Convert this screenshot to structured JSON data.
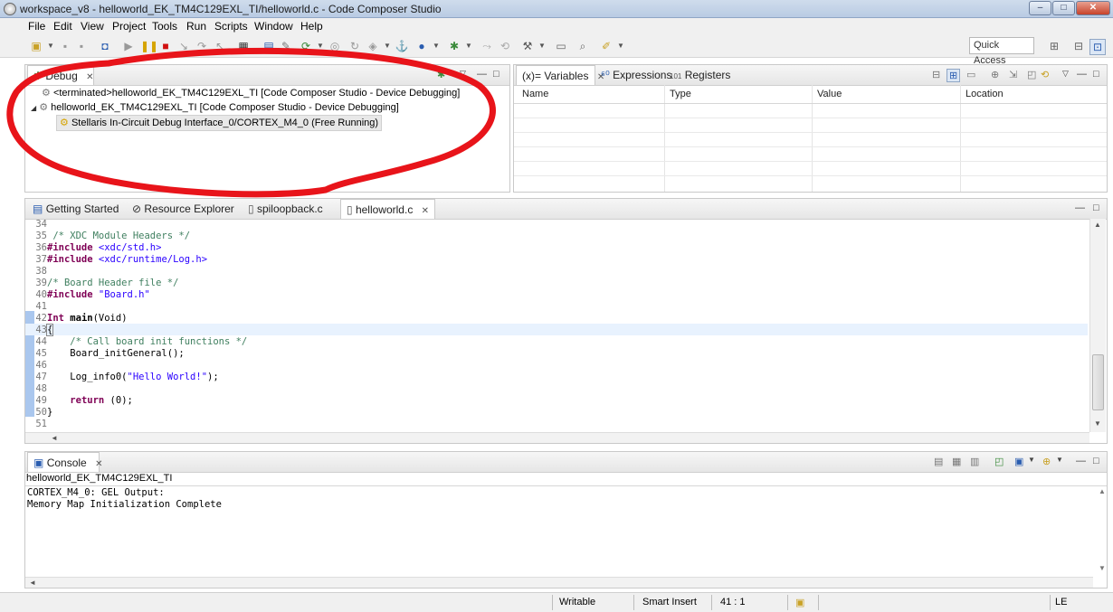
{
  "window": {
    "title": "workspace_v8 - helloworld_EK_TM4C129EXL_TI/helloworld.c - Code Composer Studio",
    "minimize": "–",
    "maximize": "□",
    "close": "✕"
  },
  "menu": [
    "File",
    "Edit",
    "View",
    "Project",
    "Tools",
    "Run",
    "Scripts",
    "Window",
    "Help"
  ],
  "toolbar": {
    "quick_access": "Quick Access"
  },
  "debug_view": {
    "tab_label": "Debug",
    "items": [
      "<terminated>helloworld_EK_TM4C129EXL_TI [Code Composer Studio - Device Debugging]",
      "helloworld_EK_TM4C129EXL_TI [Code Composer Studio - Device Debugging]",
      "Stellaris In-Circuit Debug Interface_0/CORTEX_M4_0 (Free Running)"
    ]
  },
  "variables_view": {
    "tabs": [
      "(x)= Variables",
      "Expressions",
      "Registers"
    ],
    "columns": [
      "Name",
      "Type",
      "Value",
      "Location"
    ]
  },
  "editor": {
    "tabs": [
      "Getting Started",
      "Resource Explorer",
      "spiloopback.c",
      "helloworld.c"
    ],
    "lines": [
      {
        "n": "34",
        "text": ""
      },
      {
        "n": "35",
        "text": " /* XDC Module Headers */"
      },
      {
        "n": "36",
        "text": "#include <xdc/std.h>"
      },
      {
        "n": "37",
        "text": "#include <xdc/runtime/Log.h>"
      },
      {
        "n": "38",
        "text": ""
      },
      {
        "n": "39",
        "text": "/* Board Header file */"
      },
      {
        "n": "40",
        "text": "#include \"Board.h\""
      },
      {
        "n": "41",
        "text": ""
      },
      {
        "n": "42",
        "text": "Int main(Void)"
      },
      {
        "n": "43",
        "text": "{"
      },
      {
        "n": "44",
        "text": "    /* Call board init functions */"
      },
      {
        "n": "45",
        "text": "    Board_initGeneral();"
      },
      {
        "n": "46",
        "text": ""
      },
      {
        "n": "47",
        "text": "    Log_info0(\"Hello World!\");"
      },
      {
        "n": "48",
        "text": ""
      },
      {
        "n": "49",
        "text": "    return (0);"
      },
      {
        "n": "50",
        "text": "}"
      },
      {
        "n": "51",
        "text": ""
      }
    ]
  },
  "console": {
    "tab_label": "Console",
    "session": "helloworld_EK_TM4C129EXL_TI",
    "output": [
      "CORTEX_M4_0: GEL Output:",
      "Memory Map Initialization Complete"
    ]
  },
  "status": {
    "writable": "Writable",
    "insert_mode": "Smart Insert",
    "position": "41 : 1",
    "line_ending": "LE"
  },
  "colors": {
    "annotation": "#e8141a",
    "keyword": "#7f0055",
    "comment": "#3f7f5f",
    "string": "#2a00ff",
    "current_line": "#e8f2fe"
  }
}
